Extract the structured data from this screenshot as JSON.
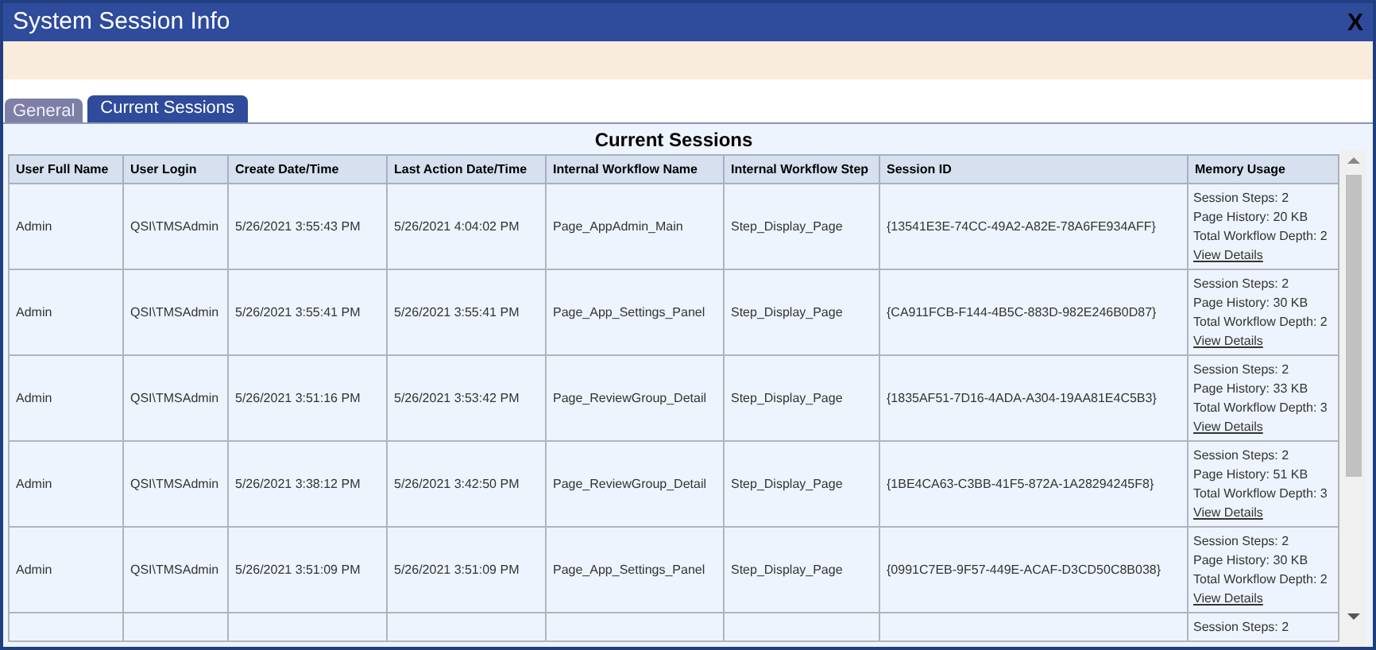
{
  "window": {
    "title": "System Session Info",
    "close": "X"
  },
  "tabs": [
    {
      "label": "General",
      "selected": false
    },
    {
      "label": "Current Sessions",
      "selected": true
    }
  ],
  "table": {
    "title": "Current Sessions",
    "columns": [
      "User Full Name",
      "User Login",
      "Create Date/Time",
      "Last Action Date/Time",
      "Internal Workflow Name",
      "Internal Workflow Step",
      "Session ID",
      "Memory Usage"
    ],
    "rows": [
      {
        "cells": [
          "Admin",
          "QSI\\TMSAdmin",
          "5/26/2021 3:55:43 PM",
          "5/26/2021 4:04:02 PM",
          "Page_AppAdmin_Main",
          "Step_Display_Page",
          "{13541E3E-74CC-49A2-A82E-78A6FE934AFF}"
        ],
        "memory": [
          "Session Steps: 2",
          "Page History: 20 KB",
          "Total Workflow Depth: 2"
        ],
        "link": "View Details"
      },
      {
        "cells": [
          "Admin",
          "QSI\\TMSAdmin",
          "5/26/2021 3:55:41 PM",
          "5/26/2021 3:55:41 PM",
          "Page_App_Settings_Panel",
          "Step_Display_Page",
          "{CA911FCB-F144-4B5C-883D-982E246B0D87}"
        ],
        "memory": [
          "Session Steps: 2",
          "Page History: 30 KB",
          "Total Workflow Depth: 2"
        ],
        "link": "View Details"
      },
      {
        "cells": [
          "Admin",
          "QSI\\TMSAdmin",
          "5/26/2021 3:51:16 PM",
          "5/26/2021 3:53:42 PM",
          "Page_ReviewGroup_Detail",
          "Step_Display_Page",
          "{1835AF51-7D16-4ADA-A304-19AA81E4C5B3}"
        ],
        "memory": [
          "Session Steps: 2",
          "Page History: 33 KB",
          "Total Workflow Depth: 3"
        ],
        "link": "View Details"
      },
      {
        "cells": [
          "Admin",
          "QSI\\TMSAdmin",
          "5/26/2021 3:38:12 PM",
          "5/26/2021 3:42:50 PM",
          "Page_ReviewGroup_Detail",
          "Step_Display_Page",
          "{1BE4CA63-C3BB-41F5-872A-1A28294245F8}"
        ],
        "memory": [
          "Session Steps: 2",
          "Page History: 51 KB",
          "Total Workflow Depth: 3"
        ],
        "link": "View Details"
      },
      {
        "cells": [
          "Admin",
          "QSI\\TMSAdmin",
          "5/26/2021 3:51:09 PM",
          "5/26/2021 3:51:09 PM",
          "Page_App_Settings_Panel",
          "Step_Display_Page",
          "{0991C7EB-9F57-449E-ACAF-D3CD50C8B038}"
        ],
        "memory": [
          "Session Steps: 2",
          "Page History: 30 KB",
          "Total Workflow Depth: 2"
        ],
        "link": "View Details"
      },
      {
        "cells": [
          "",
          "",
          "",
          "",
          "",
          "",
          ""
        ],
        "memory": [
          "Session Steps: 2"
        ]
      }
    ]
  }
}
